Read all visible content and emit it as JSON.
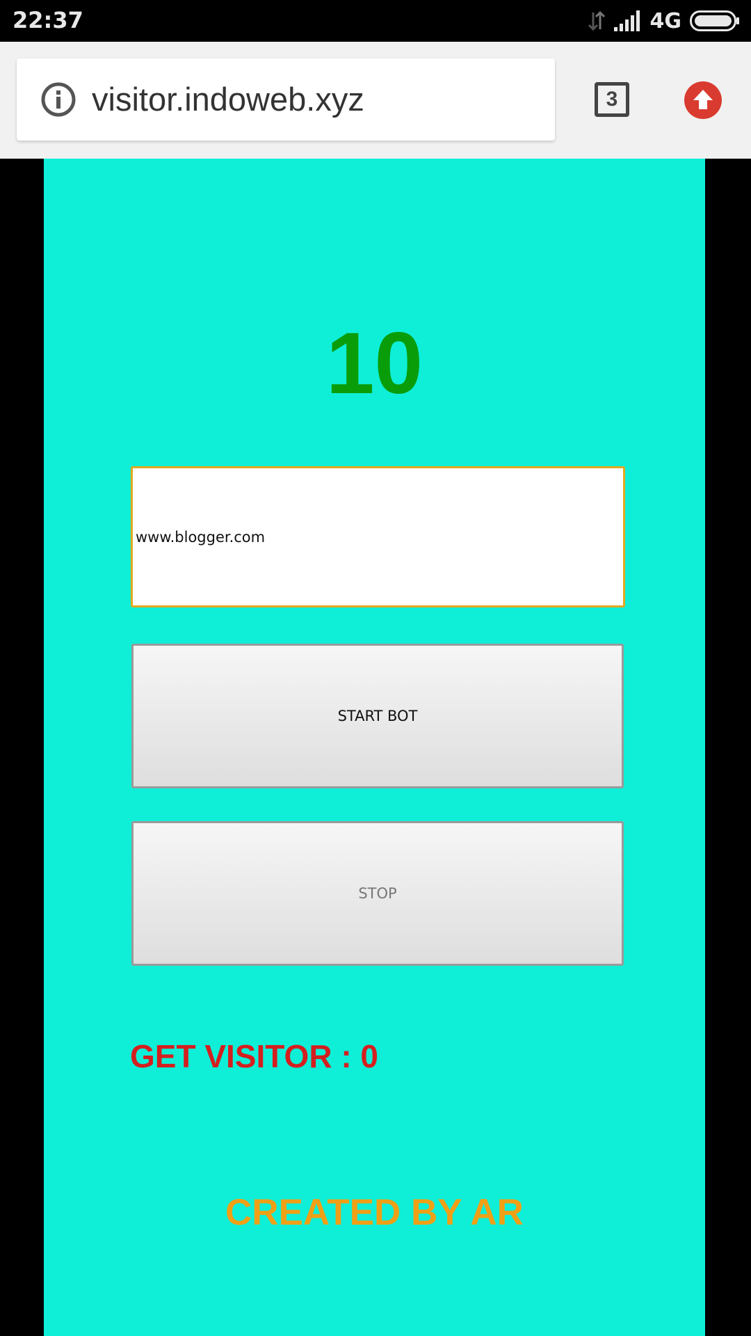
{
  "status_bar": {
    "time": "22:37",
    "network": "4G",
    "icons": [
      "data-transfer-icon",
      "signal-icon",
      "battery-icon"
    ]
  },
  "browser": {
    "url": "visitor.indoweb.xyz",
    "tab_count": "3",
    "icons": [
      "info-icon",
      "tab-switcher-icon",
      "upload-arrow-icon"
    ]
  },
  "page": {
    "background": "#0fefd8",
    "counter": "10",
    "url_input_value": "www.blogger.com",
    "start_button_label": "START BOT",
    "stop_button_label": "STOP",
    "visitor_text": "GET VISITOR : 0",
    "credit_text": "CREATED BY AR"
  },
  "colors": {
    "counter": "#0a9d0a",
    "visitor_text": "#d41f1f",
    "credit_text": "#f0a016",
    "input_border": "#e3a821",
    "upload_icon": "#d93b30"
  }
}
